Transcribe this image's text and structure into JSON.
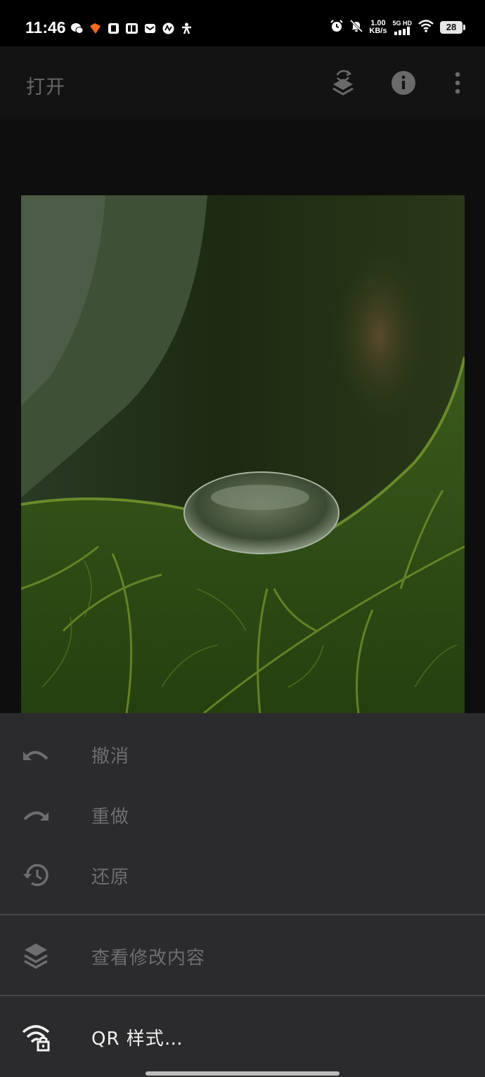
{
  "status_bar": {
    "time": "11:46",
    "net_speed_value": "1.00",
    "net_speed_unit": "KB/s",
    "signal_label": "5G HD",
    "battery": "28",
    "notification_icons": [
      "wechat-icon",
      "taobao-icon",
      "app-icon",
      "tieba-icon",
      "mail-icon",
      "app-icon-2",
      "app-icon-3"
    ],
    "system_icons": [
      "alarm-icon",
      "mute-icon",
      "signal-icon",
      "wifi-icon",
      "battery-icon"
    ]
  },
  "app_bar": {
    "open_label": "打开",
    "icons": [
      "layers-revert-icon",
      "info-icon",
      "more-vert-icon"
    ]
  },
  "menu": {
    "items": [
      {
        "label": "撤消",
        "icon": "undo-icon",
        "enabled": false
      },
      {
        "label": "重做",
        "icon": "redo-icon",
        "enabled": false
      },
      {
        "label": "还原",
        "icon": "history-icon",
        "enabled": false
      },
      {
        "label": "查看修改内容",
        "icon": "layers-icon",
        "enabled": false
      },
      {
        "label": "QR 样式…",
        "icon": "qr-style-icon",
        "enabled": true
      }
    ]
  },
  "colors": {
    "sheet_background": "#2b2b2d",
    "disabled_text": "#6e6e70",
    "enabled_text": "#f2f2f2",
    "appbar_background": "#131313"
  }
}
